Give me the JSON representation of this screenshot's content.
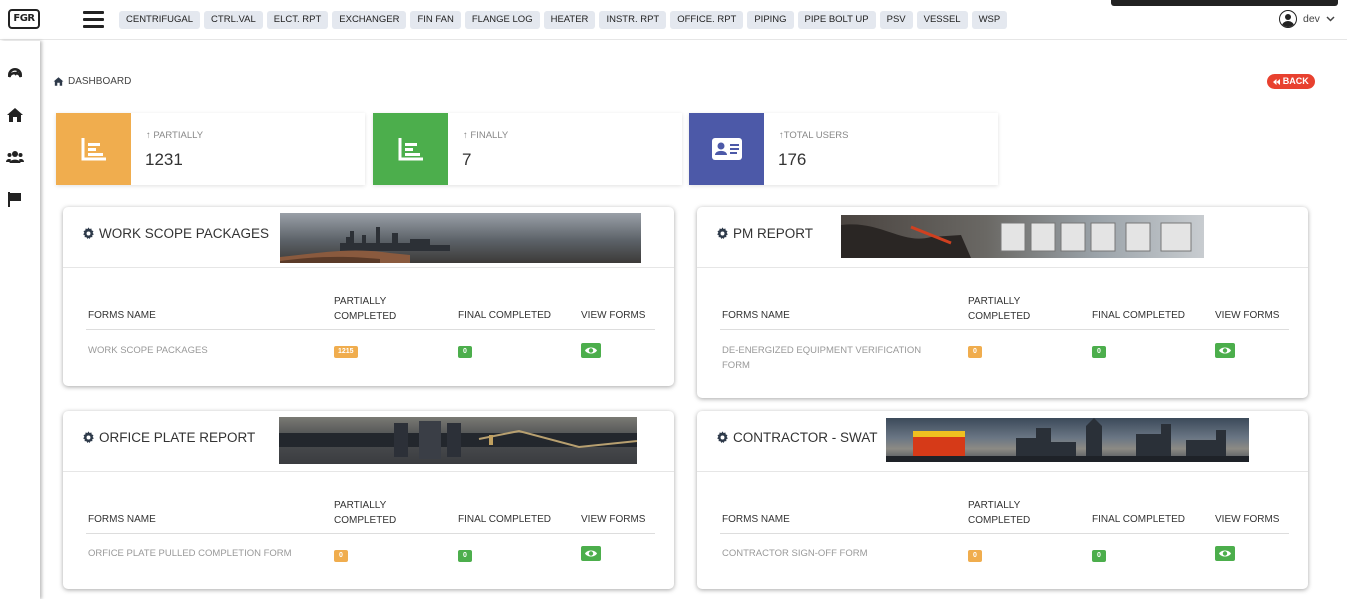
{
  "logo": {
    "text": "FGR"
  },
  "nav": {
    "tabs": [
      "CENTRIFUGAL",
      "CTRL.VAL",
      "ELCT. RPT",
      "EXCHANGER",
      "FIN FAN",
      "FLANGE LOG",
      "HEATER",
      "INSTR. RPT",
      "OFFICE. RPT",
      "PIPING",
      "PIPE BOLT UP",
      "PSV",
      "VESSEL",
      "WSP"
    ]
  },
  "user": {
    "name": "dev"
  },
  "breadcrumb": {
    "label": "DASHBOARD"
  },
  "back": {
    "label": "BACK"
  },
  "stats": [
    {
      "label": "PARTIALLY",
      "value": "1231",
      "color": "#f0ad4e",
      "icon": "bar-chart-icon"
    },
    {
      "label": "FINALLY",
      "value": "7",
      "color": "#4cae4c",
      "icon": "bar-chart-icon"
    },
    {
      "label": "TOTAL USERS",
      "value": "176",
      "color": "#4c59a8",
      "icon": "id-card-icon"
    }
  ],
  "table_headers": {
    "forms_name": "FORMS NAME",
    "partially_l1": "PARTIALLY",
    "partially_l2": "COMPLETED",
    "final": "FINAL COMPLETED",
    "view": "VIEW FORMS"
  },
  "cards": [
    {
      "title": "WORK SCOPE PACKAGES",
      "row": {
        "name": "WORK SCOPE PACKAGES",
        "partial": "1215",
        "final": "0"
      }
    },
    {
      "title": "PM REPORT",
      "row": {
        "name": "DE-ENERGIZED EQUIPMENT VERIFICATION FORM",
        "partial": "0",
        "final": "0"
      }
    },
    {
      "title": "ORFICE PLATE REPORT",
      "row": {
        "name": "ORFICE PLATE PULLED COMPLETION FORM",
        "partial": "0",
        "final": "0"
      }
    },
    {
      "title": "CONTRACTOR - SWAT",
      "row": {
        "name": "CONTRACTOR SIGN-OFF FORM",
        "partial": "0",
        "final": "0"
      }
    }
  ],
  "colors": {
    "accent_orange": "#f0ad4e",
    "accent_green": "#4cae4c",
    "accent_blue": "#4c59a8",
    "back_red": "#e8412f"
  }
}
